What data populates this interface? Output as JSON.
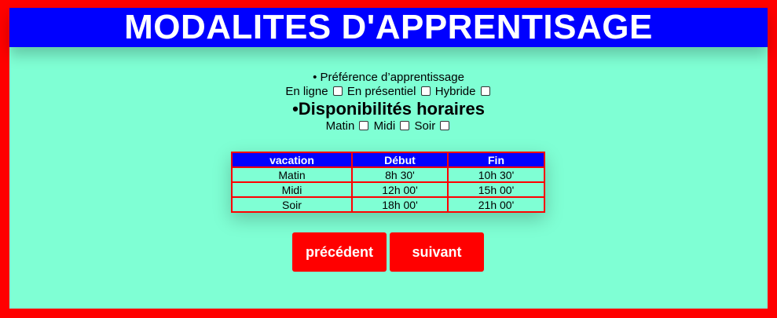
{
  "header": {
    "title": "MODALITES D'APPRENTISAGE"
  },
  "preference": {
    "label": "• Préférence d’apprentissage",
    "options": [
      "En ligne",
      "En présentiel",
      "Hybride"
    ]
  },
  "availability": {
    "label": "•Disponibilités horaires",
    "options": [
      "Matin",
      "Midi",
      "Soir"
    ]
  },
  "schedule_table": {
    "headers": [
      "vacation",
      "Début",
      "Fin"
    ],
    "rows": [
      [
        "Matin",
        "8h 30'",
        "10h 30'"
      ],
      [
        "Midi",
        "12h 00'",
        "15h 00'"
      ],
      [
        "Soir",
        "18h 00'",
        "21h 00'"
      ]
    ]
  },
  "buttons": {
    "previous": "précédent",
    "next": "suivant"
  },
  "colors": {
    "background": "#7fffd4",
    "border": "#ff0000",
    "title_bar": "#0000ff",
    "button": "#ff0000"
  }
}
